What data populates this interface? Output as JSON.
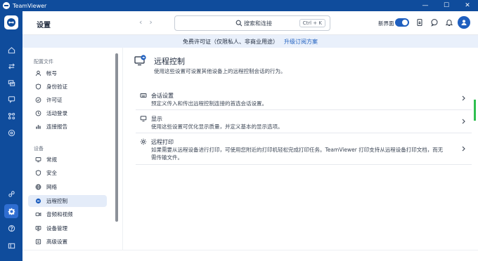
{
  "window": {
    "app_title": "TeamViewer",
    "controls": [
      "—",
      "☐",
      "✕"
    ]
  },
  "header": {
    "page_title": "设置",
    "search_placeholder": "搜索和连接",
    "search_shortcut": "Ctrl + K",
    "new_ui_label": "新界面",
    "new_ui_enabled": true
  },
  "banner": {
    "text": "免费许可证（仅限私人、非商业用途）",
    "link": "升级订阅方案"
  },
  "sidebar": {
    "section_config": "配置文件",
    "config_items": [
      {
        "label": "帐号",
        "icon": "user-icon"
      },
      {
        "label": "身份验证",
        "icon": "shield-icon"
      },
      {
        "label": "许可证",
        "icon": "license-icon"
      },
      {
        "label": "活动登录",
        "icon": "login-icon"
      },
      {
        "label": "连接报告",
        "icon": "report-icon"
      }
    ],
    "section_device": "设备",
    "device_items": [
      {
        "label": "常规",
        "icon": "monitor-icon"
      },
      {
        "label": "安全",
        "icon": "shield-icon"
      },
      {
        "label": "网络",
        "icon": "globe-icon"
      },
      {
        "label": "远程控制",
        "icon": "remote-control-icon",
        "active": true
      },
      {
        "label": "音频和视频",
        "icon": "audio-video-icon"
      },
      {
        "label": "设备管理",
        "icon": "device-management-icon"
      },
      {
        "label": "高级设置",
        "icon": "advanced-settings-icon"
      }
    ]
  },
  "main": {
    "title": "远程控制",
    "description": "使用这些设置可设置其他设备上的远程控制会话的行为。",
    "cards": [
      {
        "title": "会话设置",
        "description": "预定义传入和传出远程控制连接的首选会话设置。",
        "icon": "keyboard-icon"
      },
      {
        "title": "显示",
        "description": "使用这些设置可优化显示质量，并定义基本的显示选项。",
        "icon": "monitor-icon"
      },
      {
        "title": "远程打印",
        "description": "如果需要从远程设备进行打印，可使用您附近的打印机轻松完成打印任务。TeamViewer 打印支持从远程设备打印文档，而无需传输文件。",
        "icon": "gear-icon"
      }
    ]
  },
  "colors": {
    "brand": "#0f4c9c",
    "accent": "#1f5fbf",
    "active_bg": "#e4ecf9",
    "banner_bg": "#e9f0fb"
  }
}
